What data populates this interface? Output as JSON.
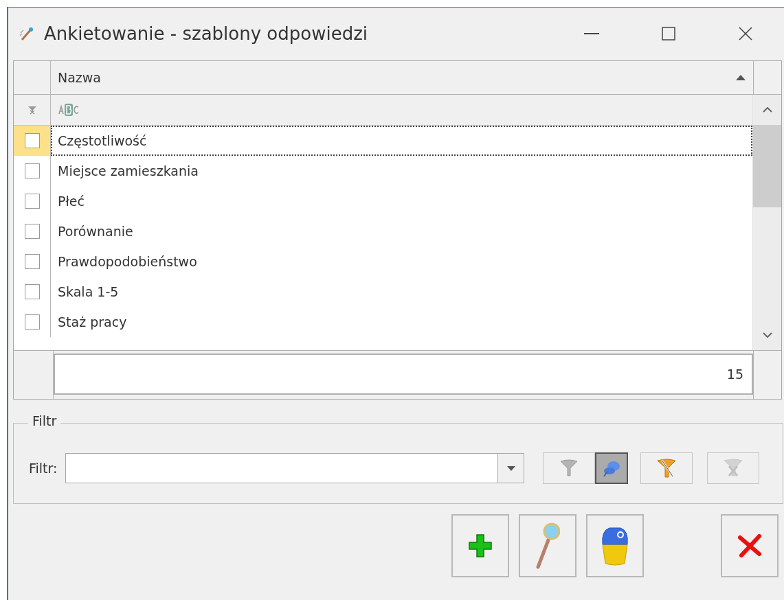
{
  "window": {
    "title": "Ankietowanie - szablony odpowiedzi"
  },
  "table": {
    "columns": [
      {
        "label": "Nazwa",
        "sort_ascending": true
      }
    ],
    "rows": [
      {
        "name": "Częstotliwość",
        "checked": false,
        "selected": true
      },
      {
        "name": "Miejsce zamieszkania",
        "checked": false,
        "selected": false
      },
      {
        "name": "Płeć",
        "checked": false,
        "selected": false
      },
      {
        "name": "Porównanie",
        "checked": false,
        "selected": false
      },
      {
        "name": "Prawdopodobieństwo",
        "checked": false,
        "selected": false
      },
      {
        "name": "Skala 1-5",
        "checked": false,
        "selected": false
      },
      {
        "name": "Staż pracy",
        "checked": false,
        "selected": false
      }
    ],
    "count": "15"
  },
  "filter": {
    "group_title": "Filtr",
    "label": "Filtr:",
    "tools": [
      {
        "kind": "funnel",
        "pressed": false,
        "disabled": false
      },
      {
        "kind": "pin",
        "pressed": true,
        "disabled": false
      },
      {
        "kind": "funnel-edit",
        "pressed": false,
        "disabled": false
      },
      {
        "kind": "funnel-clear",
        "pressed": false,
        "disabled": true
      }
    ]
  },
  "actions": [
    {
      "kind": "add"
    },
    {
      "kind": "edit"
    },
    {
      "kind": "delete"
    },
    {
      "kind": "spacer"
    },
    {
      "kind": "close"
    }
  ]
}
